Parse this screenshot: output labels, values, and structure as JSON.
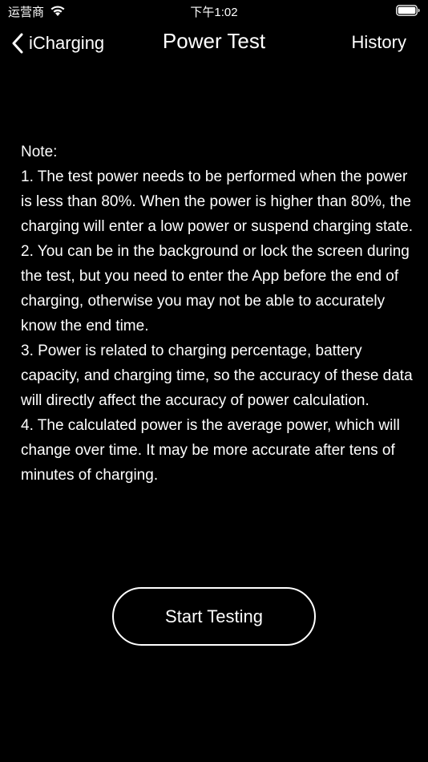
{
  "status_bar": {
    "carrier": "运营商",
    "time": "下午1:02",
    "wifi_icon": "wifi-icon",
    "battery_icon": "battery-icon",
    "battery_level": 1.0
  },
  "nav": {
    "back_label": "iCharging",
    "back_icon": "chevron-left-icon",
    "title": "Power Test",
    "history_label": "History"
  },
  "note": {
    "heading": "Note:",
    "items": [
      "1. The test power needs to be performed when the power is less than 80%. When the power is higher than 80%, the charging will enter a low power or suspend charging state.",
      "2. You can be in the background or lock the screen during the test, but you need to enter the App before the end of charging, otherwise you may not be able to accurately know the end time.",
      "3. Power is related to charging percentage, battery capacity, and charging time, so the accuracy of these data will directly affect the accuracy of power calculation.",
      "4. The calculated power is the average power, which will change over time. It may be more accurate after tens of minutes of charging."
    ]
  },
  "actions": {
    "start_label": "Start Testing"
  },
  "colors": {
    "background": "#000000",
    "text": "#ffffff"
  }
}
